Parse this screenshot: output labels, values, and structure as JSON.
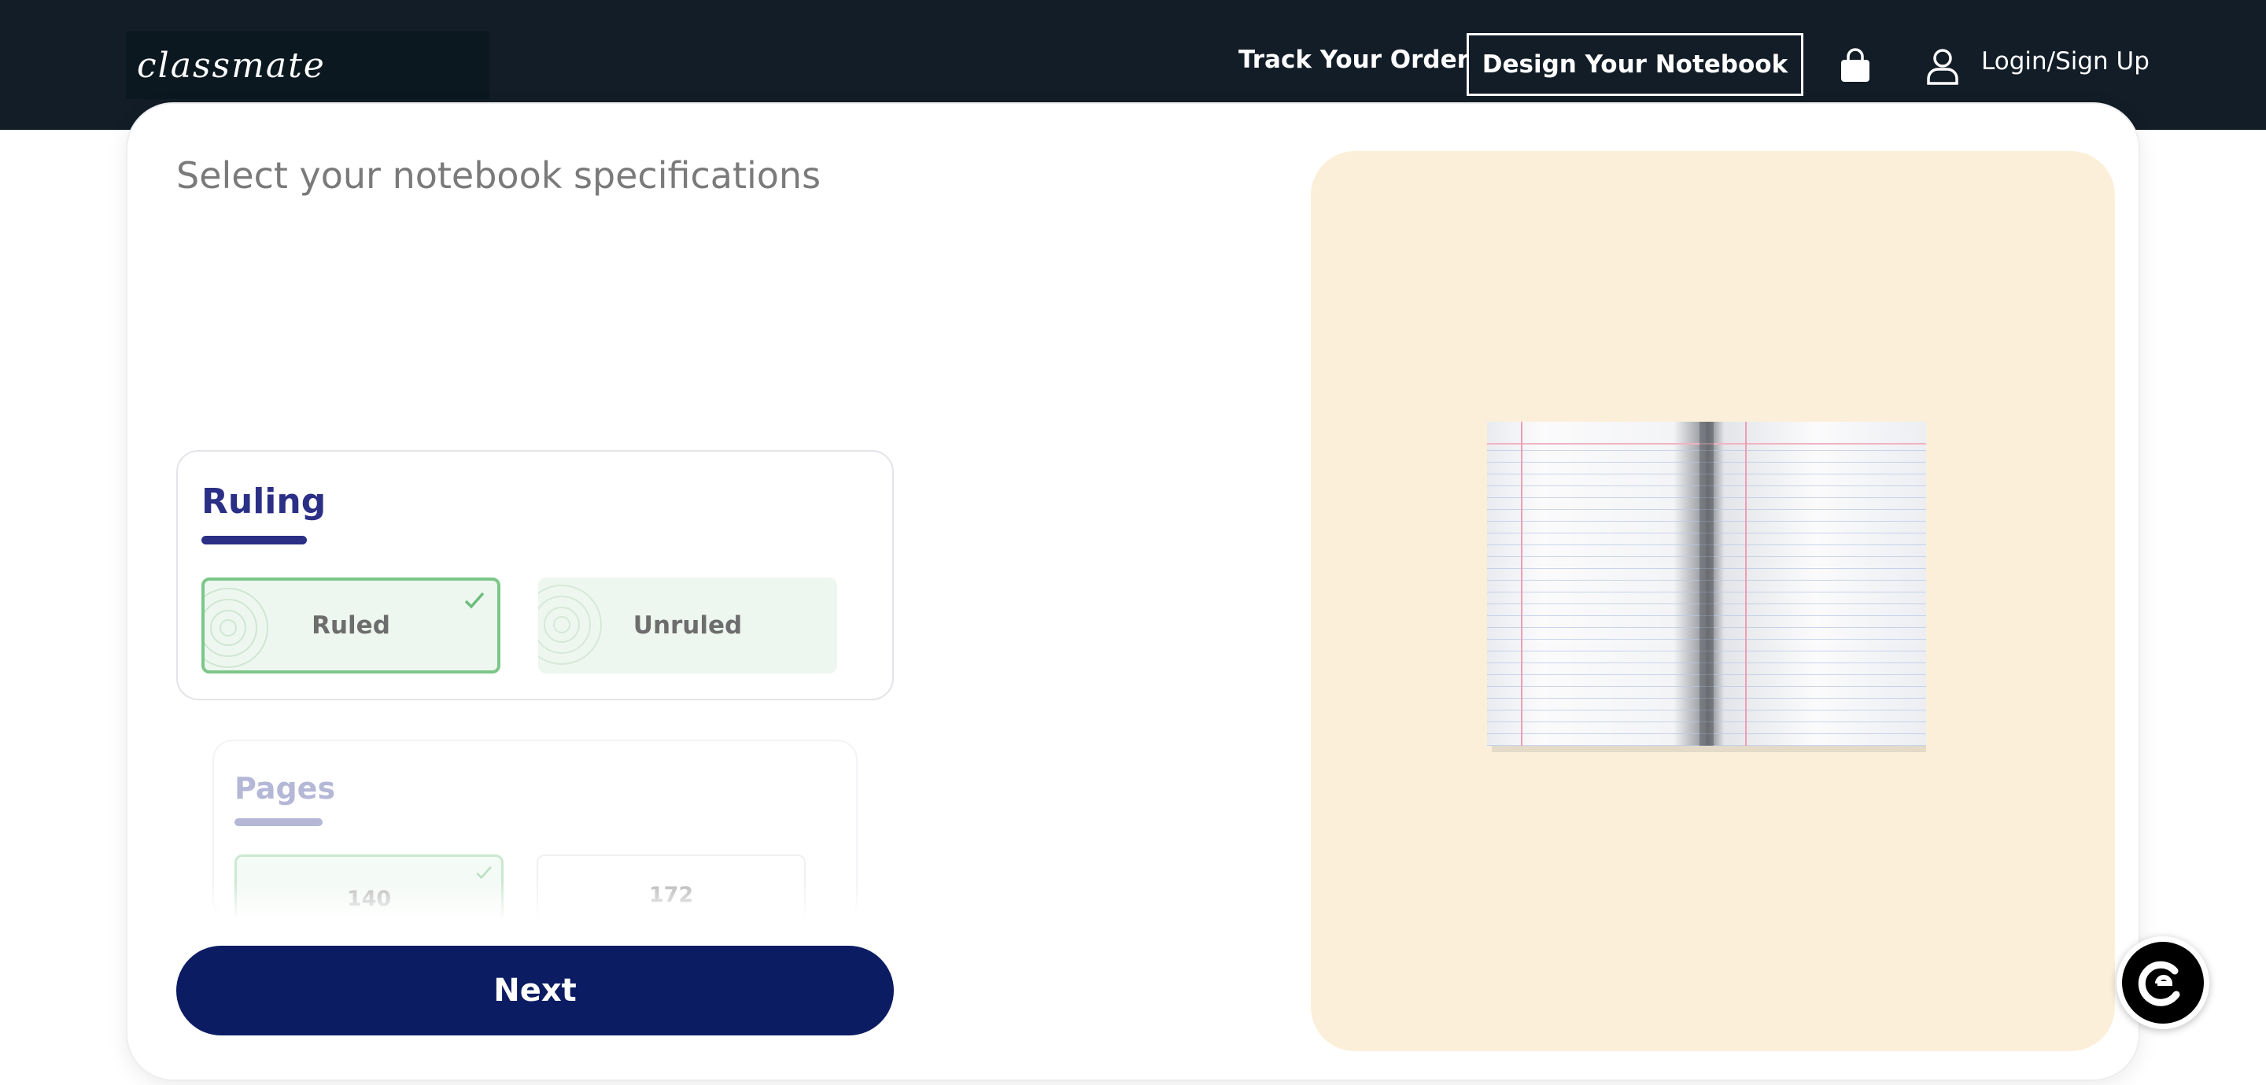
{
  "header": {
    "logo": "classmate",
    "nav": {
      "track_order": "Track Your Order",
      "design_notebook": "Design Your Notebook",
      "login": "Login/Sign Up"
    },
    "icons": [
      "bag-icon",
      "user-icon"
    ]
  },
  "main": {
    "title": "Select your notebook specifications",
    "ruling": {
      "title": "Ruling",
      "options": [
        {
          "label": "Ruled",
          "selected": true
        },
        {
          "label": "Unruled",
          "selected": false
        }
      ]
    },
    "pages": {
      "title": "Pages",
      "options": [
        {
          "label": "140",
          "selected": true
        },
        {
          "label": "172",
          "selected": false
        }
      ]
    },
    "next_label": "Next"
  },
  "colors": {
    "header_bg": "#121d27",
    "accent": "#2b2f86",
    "next_button": "#0c1c63",
    "selected_border": "#7cc68a",
    "preview_bg": "#fcefd9"
  }
}
